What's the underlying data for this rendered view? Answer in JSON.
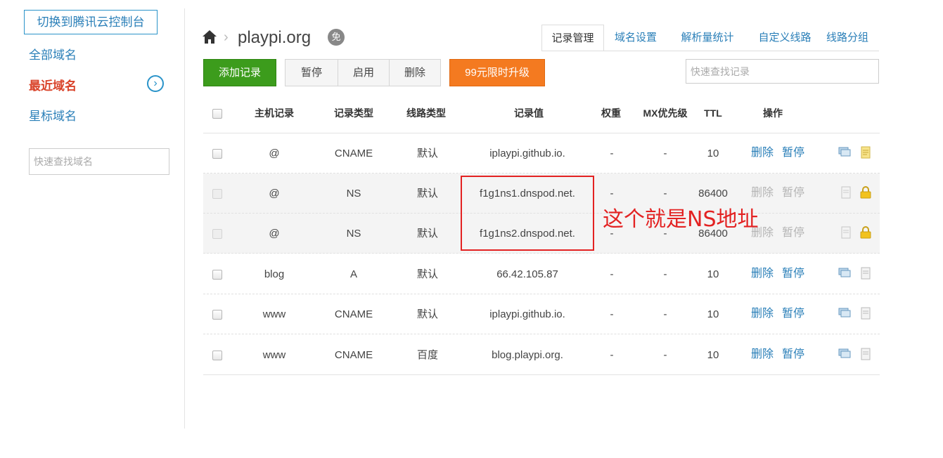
{
  "sidebar": {
    "switch_button": "切换到腾讯云控制台",
    "items": [
      {
        "label": "全部域名",
        "active": false
      },
      {
        "label": "最近域名",
        "active": true
      },
      {
        "label": "星标域名",
        "active": false
      }
    ],
    "chevron_icon": "chevron-right-circle-icon",
    "search_placeholder": "快速查找域名"
  },
  "header": {
    "home_icon": "home-icon",
    "separator": "›",
    "domain": "playpi.org",
    "badge_text": "免",
    "tabs": [
      {
        "label": "记录管理",
        "active": true
      },
      {
        "label": "域名设置",
        "active": false
      },
      {
        "label": "解析量统计",
        "active": false
      },
      {
        "label": "自定义线路",
        "active": false
      },
      {
        "label": "线路分组",
        "active": false
      }
    ]
  },
  "toolbar": {
    "add_label": "添加记录",
    "pause_label": "暂停",
    "enable_label": "启用",
    "delete_label": "删除",
    "upgrade_label": "99元限时升级",
    "search_placeholder": "快速查找记录"
  },
  "table": {
    "columns": [
      "主机记录",
      "记录类型",
      "线路类型",
      "记录值",
      "权重",
      "MX优先级",
      "TTL",
      "操作"
    ],
    "delete_label": "删除",
    "pause_label": "暂停",
    "rows": [
      {
        "host": "@",
        "type": "CNAME",
        "line": "默认",
        "value": "iplaypi.github.io.",
        "weight": "-",
        "mx": "-",
        "ttl": "10",
        "locked": false
      },
      {
        "host": "@",
        "type": "NS",
        "line": "默认",
        "value": "f1g1ns1.dnspod.net.",
        "weight": "-",
        "mx": "-",
        "ttl": "86400",
        "locked": true
      },
      {
        "host": "@",
        "type": "NS",
        "line": "默认",
        "value": "f1g1ns2.dnspod.net.",
        "weight": "-",
        "mx": "-",
        "ttl": "86400",
        "locked": true
      },
      {
        "host": "blog",
        "type": "A",
        "line": "默认",
        "value": "66.42.105.87",
        "weight": "-",
        "mx": "-",
        "ttl": "10",
        "locked": false
      },
      {
        "host": "www",
        "type": "CNAME",
        "line": "默认",
        "value": "iplaypi.github.io.",
        "weight": "-",
        "mx": "-",
        "ttl": "10",
        "locked": false
      },
      {
        "host": "www",
        "type": "CNAME",
        "line": "百度",
        "value": "blog.playpi.org.",
        "weight": "-",
        "mx": "-",
        "ttl": "10",
        "locked": false
      }
    ]
  },
  "annotation": {
    "text": "这个就是NS地址",
    "color": "#e32222"
  },
  "colors": {
    "link": "#2a7fb8",
    "active_side": "#d9432a",
    "add_button": "#3c9c1c",
    "upgrade_button": "#f47a20"
  }
}
